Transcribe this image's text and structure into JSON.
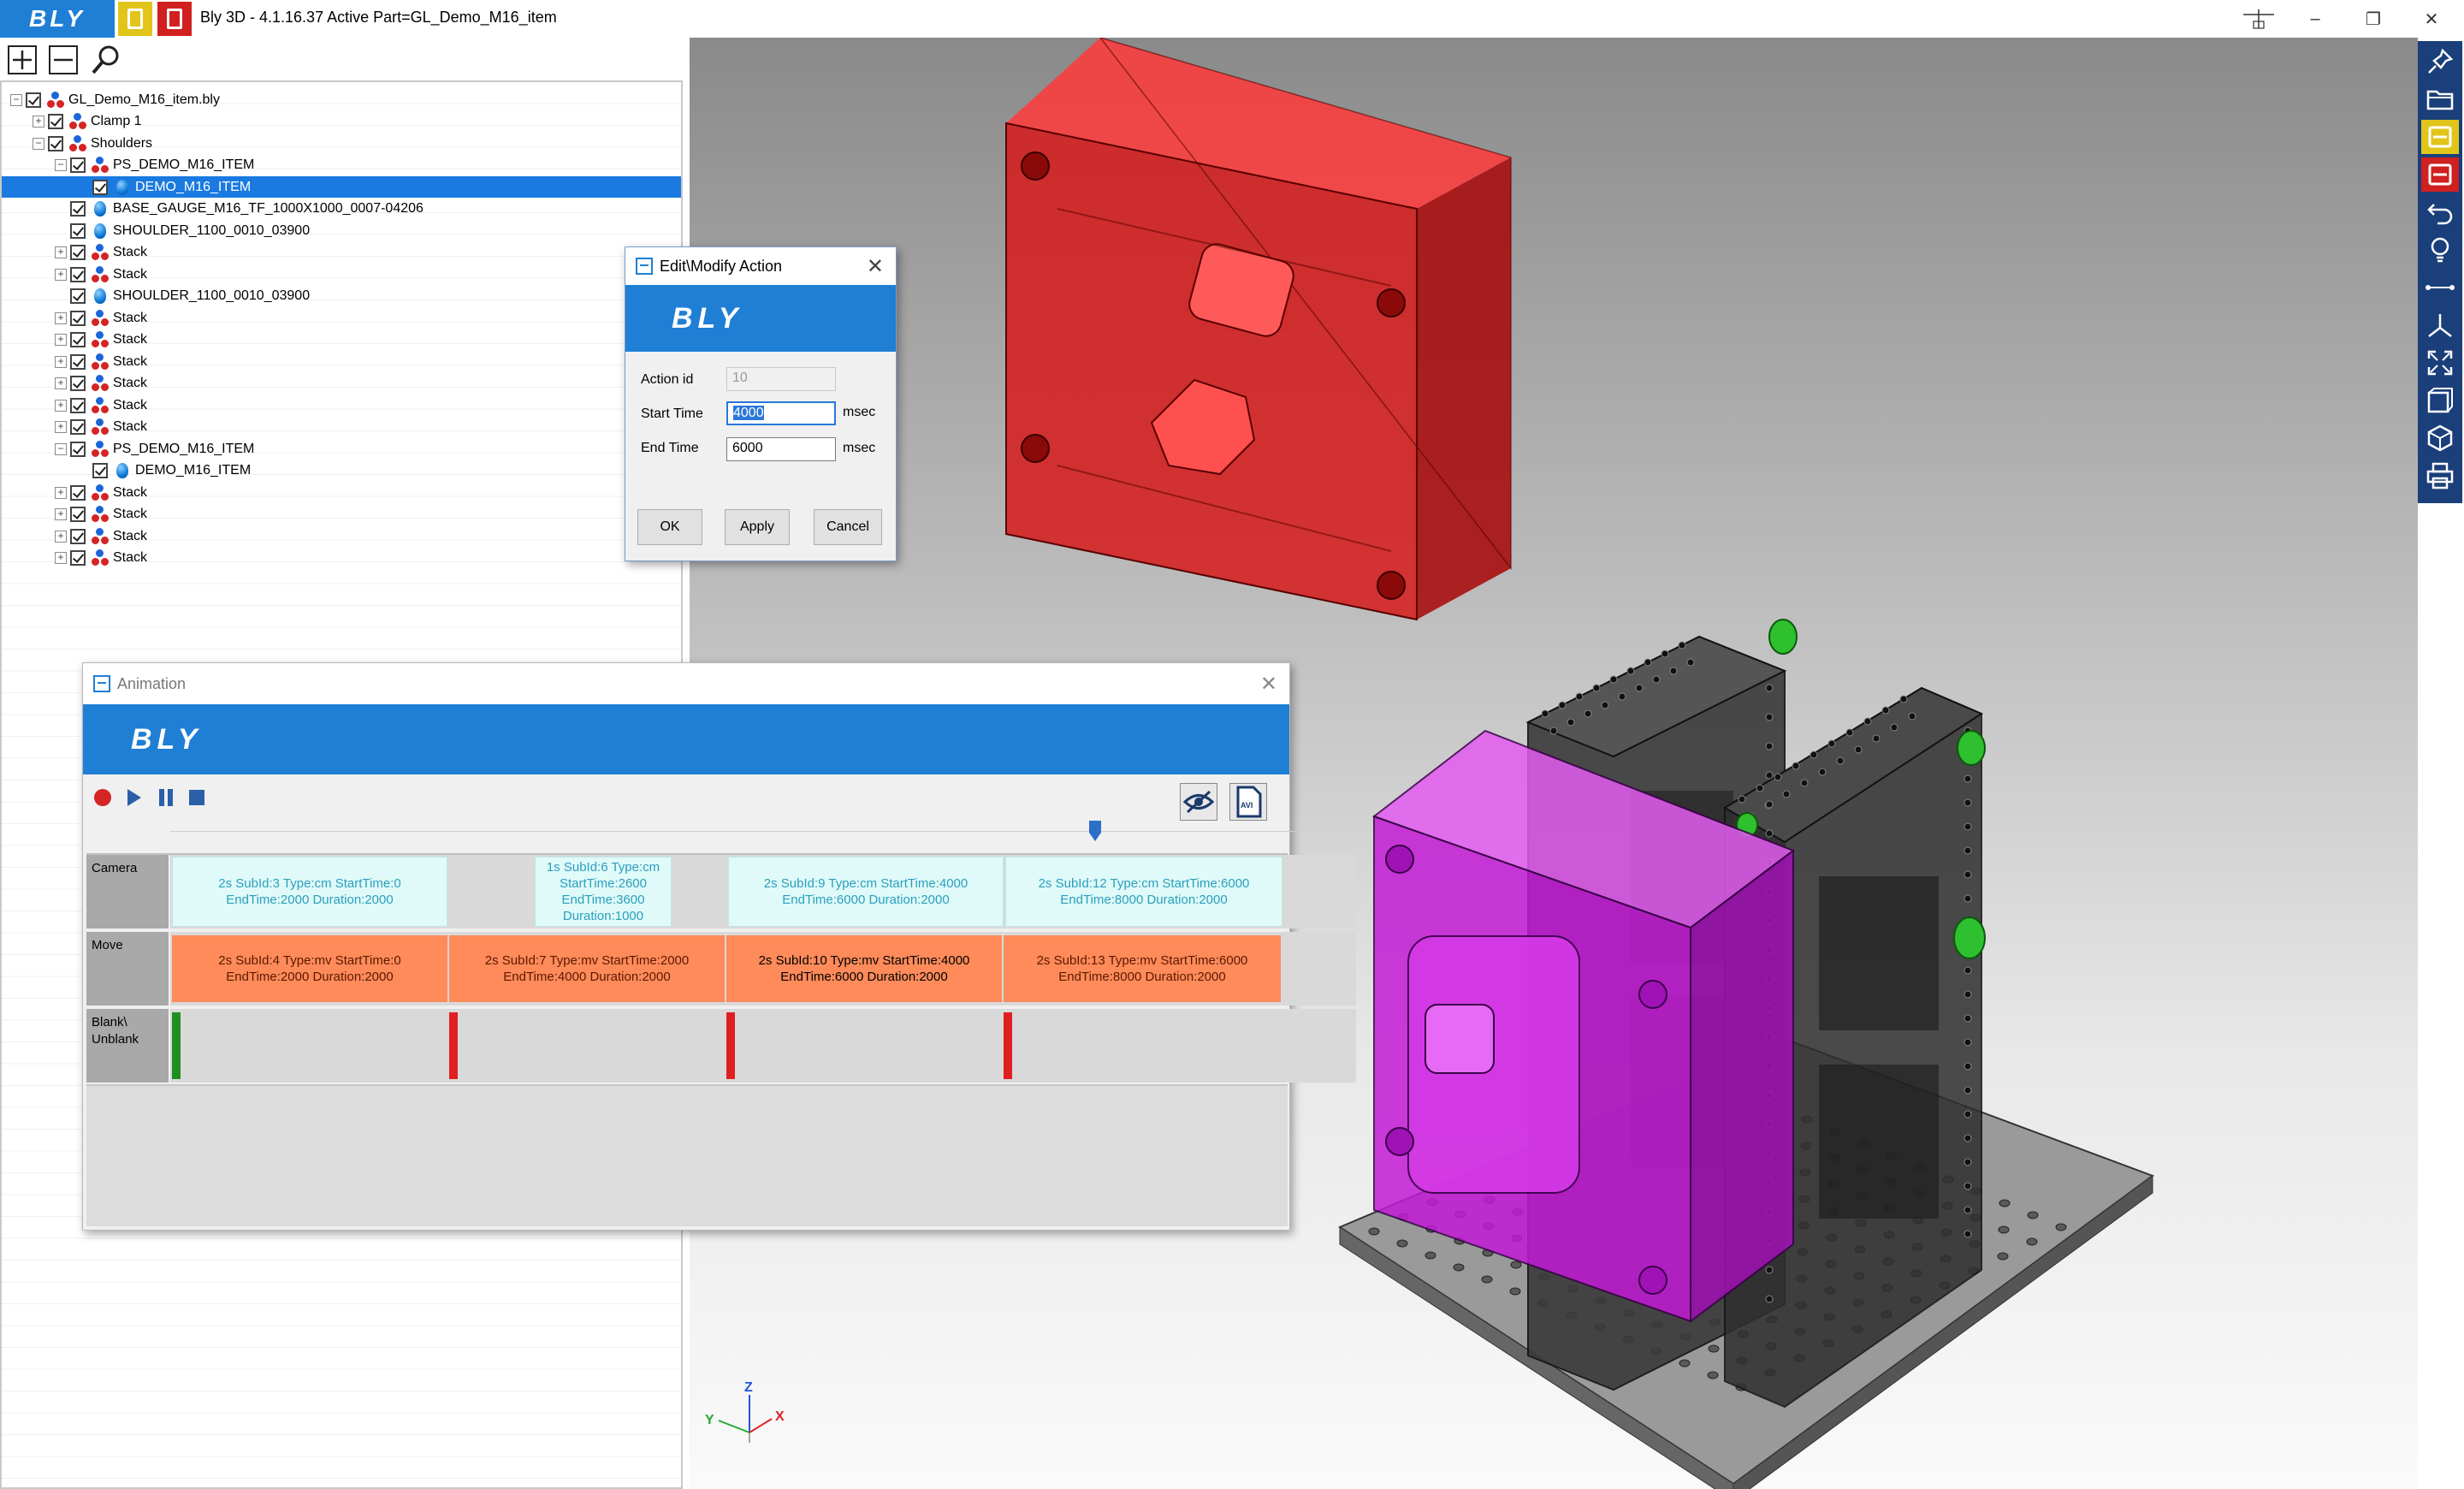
{
  "titlebar": {
    "brand": "BLY",
    "title": "Bly 3D - 4.1.16.37 Active Part=GL_Demo_M16_item",
    "minimize": "–",
    "restore": "❐",
    "close": "✕"
  },
  "colors": {
    "brand_blue": "#1f7fd5",
    "toolbar_yellow": "#e2c51b",
    "toolbar_red": "#d0201f",
    "selection_blue": "#1a7ae0",
    "camera_clip": "#dffaf8",
    "move_clip": "#ff8a5a",
    "blank_marker_green": "#1f8f1f",
    "blank_marker_red": "#e02020"
  },
  "toolbar": {
    "zoom_in_icon": "plus-icon",
    "zoom_out_icon": "minus-icon",
    "search_icon": "search-icon"
  },
  "tree": {
    "items": [
      {
        "label": "GL_Demo_M16_item.bly",
        "level": 0,
        "expander": "−",
        "type": "assembly"
      },
      {
        "label": "Clamp 1",
        "level": 1,
        "expander": "+",
        "type": "assembly"
      },
      {
        "label": "Shoulders",
        "level": 1,
        "expander": "−",
        "type": "assembly"
      },
      {
        "label": "PS_DEMO_M16_ITEM",
        "level": 2,
        "expander": "−",
        "type": "assembly"
      },
      {
        "label": "DEMO_M16_ITEM",
        "level": 3,
        "expander": "",
        "type": "part",
        "selected": true
      },
      {
        "label": "BASE_GAUGE_M16_TF_1000X1000_0007-04206",
        "level": 2,
        "expander": "",
        "type": "part"
      },
      {
        "label": "SHOULDER_1100_0010_03900",
        "level": 2,
        "expander": "",
        "type": "part"
      },
      {
        "label": "Stack",
        "level": 2,
        "expander": "+",
        "type": "assembly"
      },
      {
        "label": "Stack",
        "level": 2,
        "expander": "+",
        "type": "assembly"
      },
      {
        "label": "SHOULDER_1100_0010_03900",
        "level": 2,
        "expander": "",
        "type": "part"
      },
      {
        "label": "Stack",
        "level": 2,
        "expander": "+",
        "type": "assembly"
      },
      {
        "label": "Stack",
        "level": 2,
        "expander": "+",
        "type": "assembly"
      },
      {
        "label": "Stack",
        "level": 2,
        "expander": "+",
        "type": "assembly"
      },
      {
        "label": "Stack",
        "level": 2,
        "expander": "+",
        "type": "assembly"
      },
      {
        "label": "Stack",
        "level": 2,
        "expander": "+",
        "type": "assembly"
      },
      {
        "label": "Stack",
        "level": 2,
        "expander": "+",
        "type": "assembly"
      },
      {
        "label": "PS_DEMO_M16_ITEM",
        "level": 2,
        "expander": "−",
        "type": "assembly"
      },
      {
        "label": "DEMO_M16_ITEM",
        "level": 3,
        "expander": "",
        "type": "part"
      },
      {
        "label": "Stack",
        "level": 2,
        "expander": "+",
        "type": "assembly"
      },
      {
        "label": "Stack",
        "level": 2,
        "expander": "+",
        "type": "assembly"
      },
      {
        "label": "Stack",
        "level": 2,
        "expander": "+",
        "type": "assembly"
      },
      {
        "label": "Stack",
        "level": 2,
        "expander": "+",
        "type": "assembly"
      }
    ]
  },
  "edit_dialog": {
    "title": "Edit\\Modify Action",
    "brand": "BLY",
    "action_id_label": "Action id",
    "action_id_value": "10",
    "start_time_label": "Start Time",
    "start_time_value": "4000",
    "end_time_label": "End Time",
    "end_time_value": "6000",
    "unit": "msec",
    "ok": "OK",
    "apply": "Apply",
    "cancel": "Cancel"
  },
  "animation": {
    "title": "Animation",
    "brand": "BLY",
    "playhead_fraction": 0.78,
    "tracks": [
      {
        "label": "Camera"
      },
      {
        "label": "Move"
      },
      {
        "label": "Blank\\ Unblank"
      }
    ],
    "camera_clips": [
      {
        "line1": "2s SubId:3 Type:cm StartTime:0",
        "line2": "EndTime:2000 Duration:2000"
      },
      {
        "line1": "1s SubId:6 Type:cm",
        "line2": "StartTime:2600",
        "line3": "EndTime:3600",
        "line4": "Duration:1000"
      },
      {
        "line1": "2s SubId:9 Type:cm StartTime:4000",
        "line2": "EndTime:6000 Duration:2000"
      },
      {
        "line1": "2s SubId:12 Type:cm StartTime:6000",
        "line2": "EndTime:8000 Duration:2000"
      }
    ],
    "move_clips": [
      {
        "line1": "2s SubId:4 Type:mv StartTime:0",
        "line2": "EndTime:2000 Duration:2000"
      },
      {
        "line1": "2s SubId:7 Type:mv StartTime:2000",
        "line2": "EndTime:4000 Duration:2000"
      },
      {
        "line1": "2s SubId:10 Type:mv StartTime:4000",
        "line2": "EndTime:6000 Duration:2000"
      },
      {
        "line1": "2s SubId:13 Type:mv StartTime:6000",
        "line2": "EndTime:8000 Duration:2000"
      }
    ],
    "blank_markers": [
      "green",
      "red",
      "red",
      "red"
    ]
  },
  "viewport": {
    "axis_z": "Z",
    "axis_y": "Y",
    "axis_x": "X"
  },
  "right_toolbar": {
    "icons": [
      "pin-icon",
      "open-folder-icon",
      "yellow-panel-icon",
      "red-panel-icon",
      "undo-icon",
      "lightbulb-icon",
      "measure-icon",
      "axis-triad-icon",
      "fit-view-icon",
      "view-cube-icon",
      "shaded-view-icon",
      "print-icon"
    ]
  }
}
